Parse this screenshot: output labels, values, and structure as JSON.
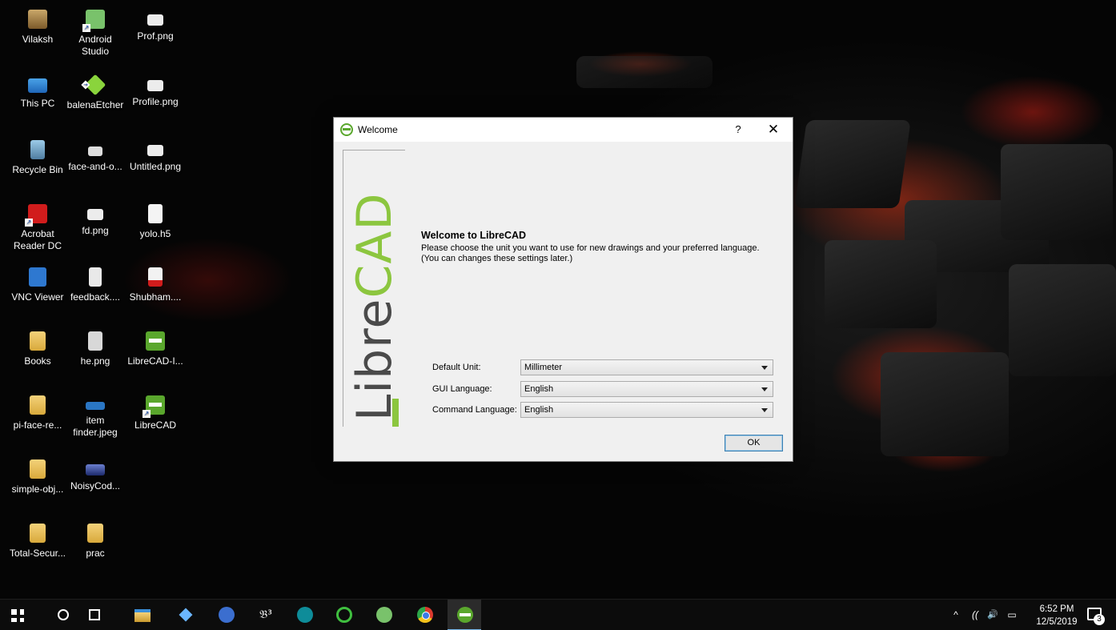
{
  "desktop": {
    "icons": [
      {
        "label_1": "Vilaksh",
        "label_2": "",
        "icon": "user-folder-icon"
      },
      {
        "label_1": "Android",
        "label_2": "Studio",
        "icon": "android-studio-icon"
      },
      {
        "label_1": "Prof.png",
        "label_2": "",
        "icon": "image-file-icon"
      },
      {
        "label_1": "This PC",
        "label_2": "",
        "icon": "computer-icon"
      },
      {
        "label_1": "balenaEtcher",
        "label_2": "",
        "icon": "balena-etcher-icon"
      },
      {
        "label_1": "Profile.png",
        "label_2": "",
        "icon": "image-file-icon"
      },
      {
        "label_1": "Recycle Bin",
        "label_2": "",
        "icon": "recycle-bin-icon"
      },
      {
        "label_1": "face-and-o...",
        "label_2": "",
        "icon": "cloud-folder-icon"
      },
      {
        "label_1": "Untitled.png",
        "label_2": "",
        "icon": "image-file-icon"
      },
      {
        "label_1": "Acrobat",
        "label_2": "Reader DC",
        "icon": "acrobat-reader-icon"
      },
      {
        "label_1": "fd.png",
        "label_2": "",
        "icon": "image-file-icon"
      },
      {
        "label_1": "yolo.h5",
        "label_2": "",
        "icon": "blank-file-icon"
      },
      {
        "label_1": "VNC Viewer",
        "label_2": "",
        "icon": "vnc-viewer-icon"
      },
      {
        "label_1": "feedback....",
        "label_2": "",
        "icon": "document-file-icon"
      },
      {
        "label_1": "Shubham....",
        "label_2": "",
        "icon": "pdf-file-icon"
      },
      {
        "label_1": "Books",
        "label_2": "",
        "icon": "folder-icon"
      },
      {
        "label_1": "he.png",
        "label_2": "",
        "icon": "image-file-icon"
      },
      {
        "label_1": "LibreCAD-I...",
        "label_2": "",
        "icon": "librecad-installer-icon"
      },
      {
        "label_1": "pi-face-re...",
        "label_2": "",
        "icon": "folder-icon"
      },
      {
        "label_1": "item",
        "label_2": "finder.jpeg",
        "icon": "image-file-icon"
      },
      {
        "label_1": "LibreCAD",
        "label_2": "",
        "icon": "librecad-icon"
      },
      {
        "label_1": "simple-obj...",
        "label_2": "",
        "icon": "folder-icon"
      },
      {
        "label_1": "NoisyCod...",
        "label_2": "",
        "icon": "image-file-icon"
      },
      {
        "label_1": "Total-Secur...",
        "label_2": "",
        "icon": "folder-icon"
      },
      {
        "label_1": "prac",
        "label_2": "",
        "icon": "folder-icon"
      }
    ]
  },
  "dialog": {
    "title": "Welcome",
    "help_label": "?",
    "close_label": "✕",
    "logo_text_dark": "Libre",
    "logo_text_green": "CAD",
    "heading": "Welcome to LibreCAD",
    "description_line_1": "Please choose the unit you want to use for new drawings and your preferred language.",
    "description_line_2": "(You can changes these settings later.)",
    "default_unit_label": "Default Unit:",
    "default_unit_value": "Millimeter",
    "gui_language_label": "GUI Language:",
    "gui_language_value": "English",
    "command_language_label": "Command Language:",
    "command_language_value": "English",
    "ok_label": "OK"
  },
  "taskbar": {
    "items": [
      "start-icon",
      "search-icon",
      "task-view-icon",
      "file-explorer-icon",
      "pin-app-icon",
      "google-app-icon",
      "b3-app-icon",
      "arduino-icon",
      "ring-app-icon",
      "android-studio-icon",
      "chrome-icon",
      "librecad-icon"
    ],
    "b3_label": "𝔅³",
    "tray": {
      "chevron": "^",
      "network": "((",
      "volume": "🔊",
      "battery": "▭",
      "time": "6:52 PM",
      "date": "12/5/2019",
      "notification_count": "3"
    }
  }
}
